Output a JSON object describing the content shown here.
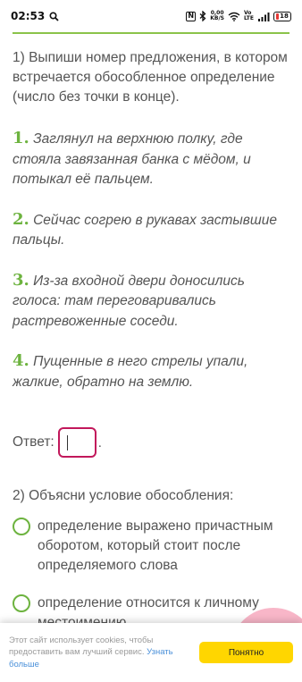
{
  "status_bar": {
    "time": "02:53",
    "net_speed_top": "0,00",
    "net_speed_bottom": "KB/S",
    "battery": "18"
  },
  "question1": {
    "prompt": "1) Выпиши номер предложения, в котором встречается обособленное определение (число без точки в конце).",
    "options": [
      {
        "num": "1.",
        "text": "Заглянул на верхнюю полку, где стояла завязанная банка с мёдом, и потыкал её пальцем."
      },
      {
        "num": "2.",
        "text": "Сейчас согрею в рукавах застывшие пальцы."
      },
      {
        "num": "3.",
        "text": "Из-за входной двери доносились голоса: там переговаривались растревоженные соседи."
      },
      {
        "num": "4.",
        "text": "Пущенные в него стрелы упали, жалкие, обратно на землю."
      }
    ],
    "answer_label": "Ответ:",
    "answer_value": "",
    "answer_suffix": "."
  },
  "question2": {
    "prompt": "2) Объясни условие обособления:",
    "options": [
      {
        "text": "определение выражено причастным оборотом, который стоит после определяемого слова"
      },
      {
        "text": "определение относится к личному местоимению"
      }
    ]
  },
  "cookie_banner": {
    "text": "Этот сайт использует cookies, чтобы предоставить вам лучший сервис.",
    "link": "Узнать больше",
    "button": "Понятно",
    "button_color": "#ffd600"
  },
  "colors": {
    "accent_green": "#6db33f",
    "input_border": "#c2185b"
  }
}
